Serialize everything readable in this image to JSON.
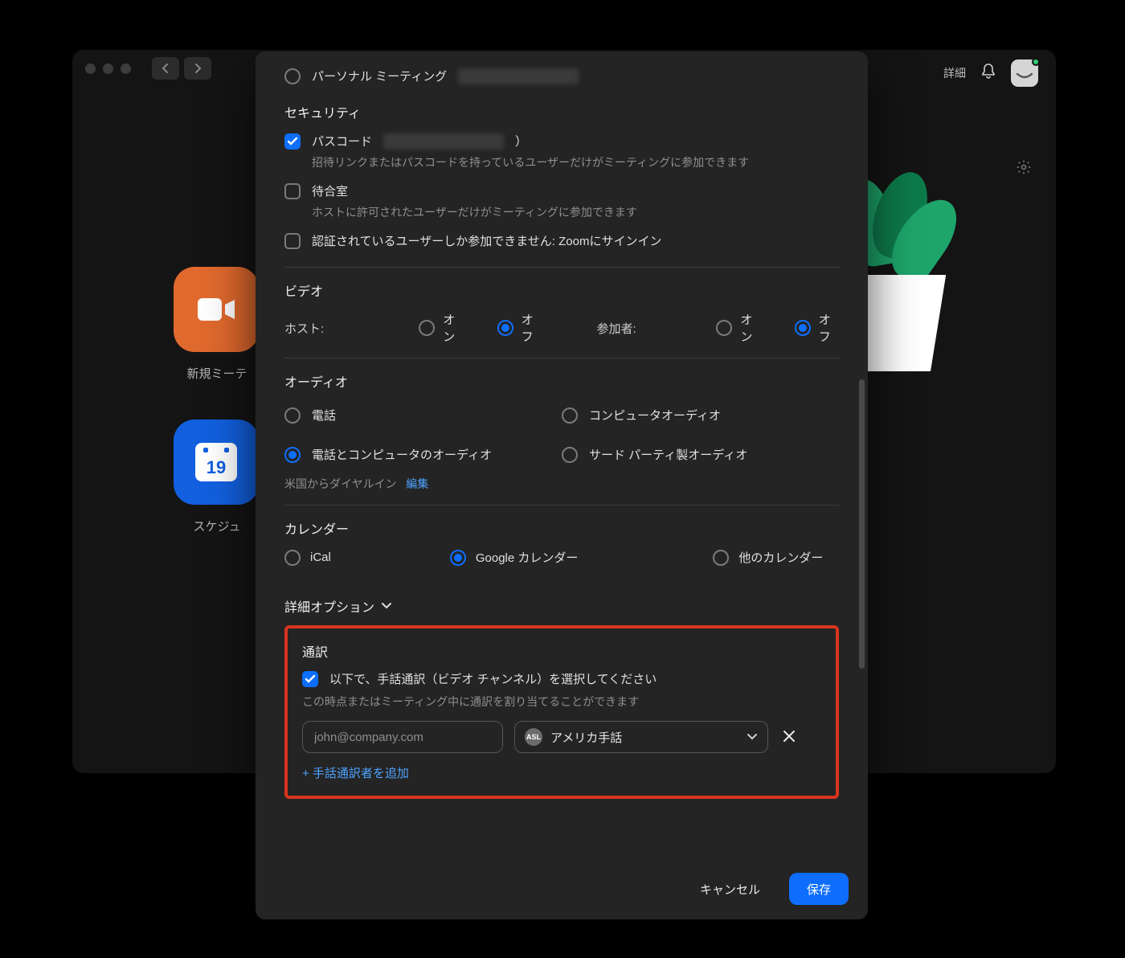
{
  "bg": {
    "details": "詳細",
    "tile_orange_label": "新規ミーテ",
    "tile_blue_label": "スケジュ",
    "cal_date": "19"
  },
  "pmi": {
    "label": "パーソナル ミーティング"
  },
  "security": {
    "title": "セキュリティ",
    "passcode_label": "パスコード",
    "passcode_suffix": "）",
    "passcode_help": "招待リンクまたはパスコードを持っているユーザーだけがミーティングに参加できます",
    "waitroom_label": "待合室",
    "waitroom_help": "ホストに許可されたユーザーだけがミーティングに参加できます",
    "auth_label": "認証されているユーザーしか参加できません: Zoomにサインイン"
  },
  "video": {
    "title": "ビデオ",
    "host_label": "ホスト:",
    "participant_label": "参加者:",
    "on": "オン",
    "off": "オフ"
  },
  "audio": {
    "title": "オーディオ",
    "opt_phone": "電話",
    "opt_computer": "コンピュータオーディオ",
    "opt_both": "電話とコンピュータのオーディオ",
    "opt_thirdparty": "サード パーティ製オーディオ",
    "dial_from": "米国からダイヤルイン",
    "edit": "編集"
  },
  "calendar": {
    "title": "カレンダー",
    "ical": "iCal",
    "google": "Google カレンダー",
    "other": "他のカレンダー"
  },
  "advanced": {
    "title": "詳細オプション"
  },
  "interp": {
    "title": "通訳",
    "checkbox_label": "以下で、手話通訳（ビデオ チャンネル）を選択してください",
    "help": "この時点またはミーティング中に通訳を割り当てることができます",
    "email_placeholder": "john@company.com",
    "asl_badge": "ASL",
    "lang_selected": "アメリカ手話",
    "add_label": "+ 手話通訳者を追加"
  },
  "footer": {
    "cancel": "キャンセル",
    "save": "保存"
  }
}
